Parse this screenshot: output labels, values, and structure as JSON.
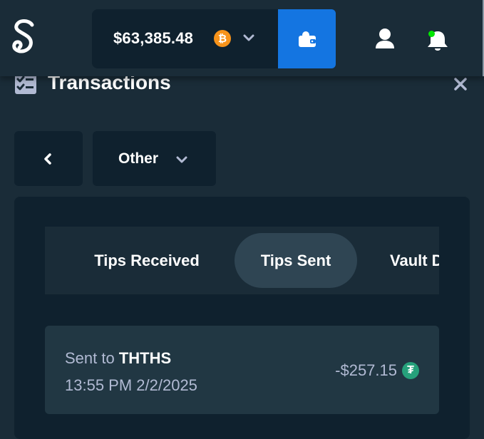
{
  "header": {
    "balance": "$63,385.48",
    "currency_icon": "bitcoin-icon",
    "currency_symbol": "₿",
    "colors": {
      "bar": "#1a2c38",
      "balance_bg": "#0f212e",
      "wallet_button": "#1475e1",
      "online": "#00e701"
    }
  },
  "panel": {
    "title": "Transactions",
    "filter_label": "Other"
  },
  "tabs": [
    {
      "label": "Tips Received",
      "active": false
    },
    {
      "label": "Tips Sent",
      "active": true
    },
    {
      "label": "Vault D"
    }
  ],
  "transactions": [
    {
      "prefix": "Sent to ",
      "user": "THTHS",
      "time": "13:55 PM 2/2/2025",
      "amount": "-$257.15",
      "currency_icon": "tether-icon",
      "currency_symbol": "₮"
    }
  ]
}
